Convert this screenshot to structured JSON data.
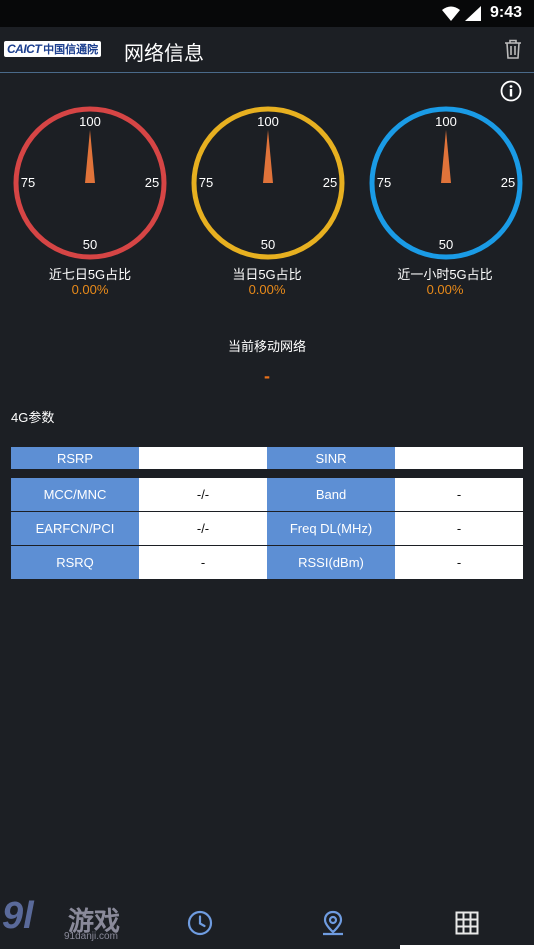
{
  "status": {
    "time": "9:43"
  },
  "appbar": {
    "logo_text": "CAICT",
    "logo_cn": "中国信通院",
    "title": "网络信息"
  },
  "gauges": [
    {
      "label": "近七日5G占比",
      "value": "0.00%",
      "ticks": {
        "top": "100",
        "left": "75",
        "right": "25",
        "bottom": "50"
      },
      "color": "#d64545"
    },
    {
      "label": "当日5G占比",
      "value": "0.00%",
      "ticks": {
        "top": "100",
        "left": "75",
        "right": "25",
        "bottom": "50"
      },
      "color": "#e7b020"
    },
    {
      "label": "近一小时5G占比",
      "value": "0.00%",
      "ticks": {
        "top": "100",
        "left": "75",
        "right": "25",
        "bottom": "50"
      },
      "color": "#1a9be6"
    }
  ],
  "network": {
    "title": "当前移动网络",
    "value": "-"
  },
  "section": {
    "title": "4G参数"
  },
  "top_row": {
    "rsrp_label": "RSRP",
    "rsrp_value": "",
    "sinr_label": "SINR",
    "sinr_value": ""
  },
  "rows": [
    {
      "l1": "MCC/MNC",
      "v1": "-/-",
      "l2": "Band",
      "v2": "-"
    },
    {
      "l1": "EARFCN/PCI",
      "v1": "-/-",
      "l2": "Freq DL(MHz)",
      "v2": "-"
    },
    {
      "l1": "RSRQ",
      "v1": "-",
      "l2": "RSSI(dBm)",
      "v2": "-"
    }
  ],
  "watermark": {
    "brand": "9l",
    "cn": "游戏",
    "url": "91danji.com"
  },
  "colors": {
    "accent": "#e88a1a",
    "label_bg": "#5d8fd4",
    "needle": "#e0733a"
  }
}
